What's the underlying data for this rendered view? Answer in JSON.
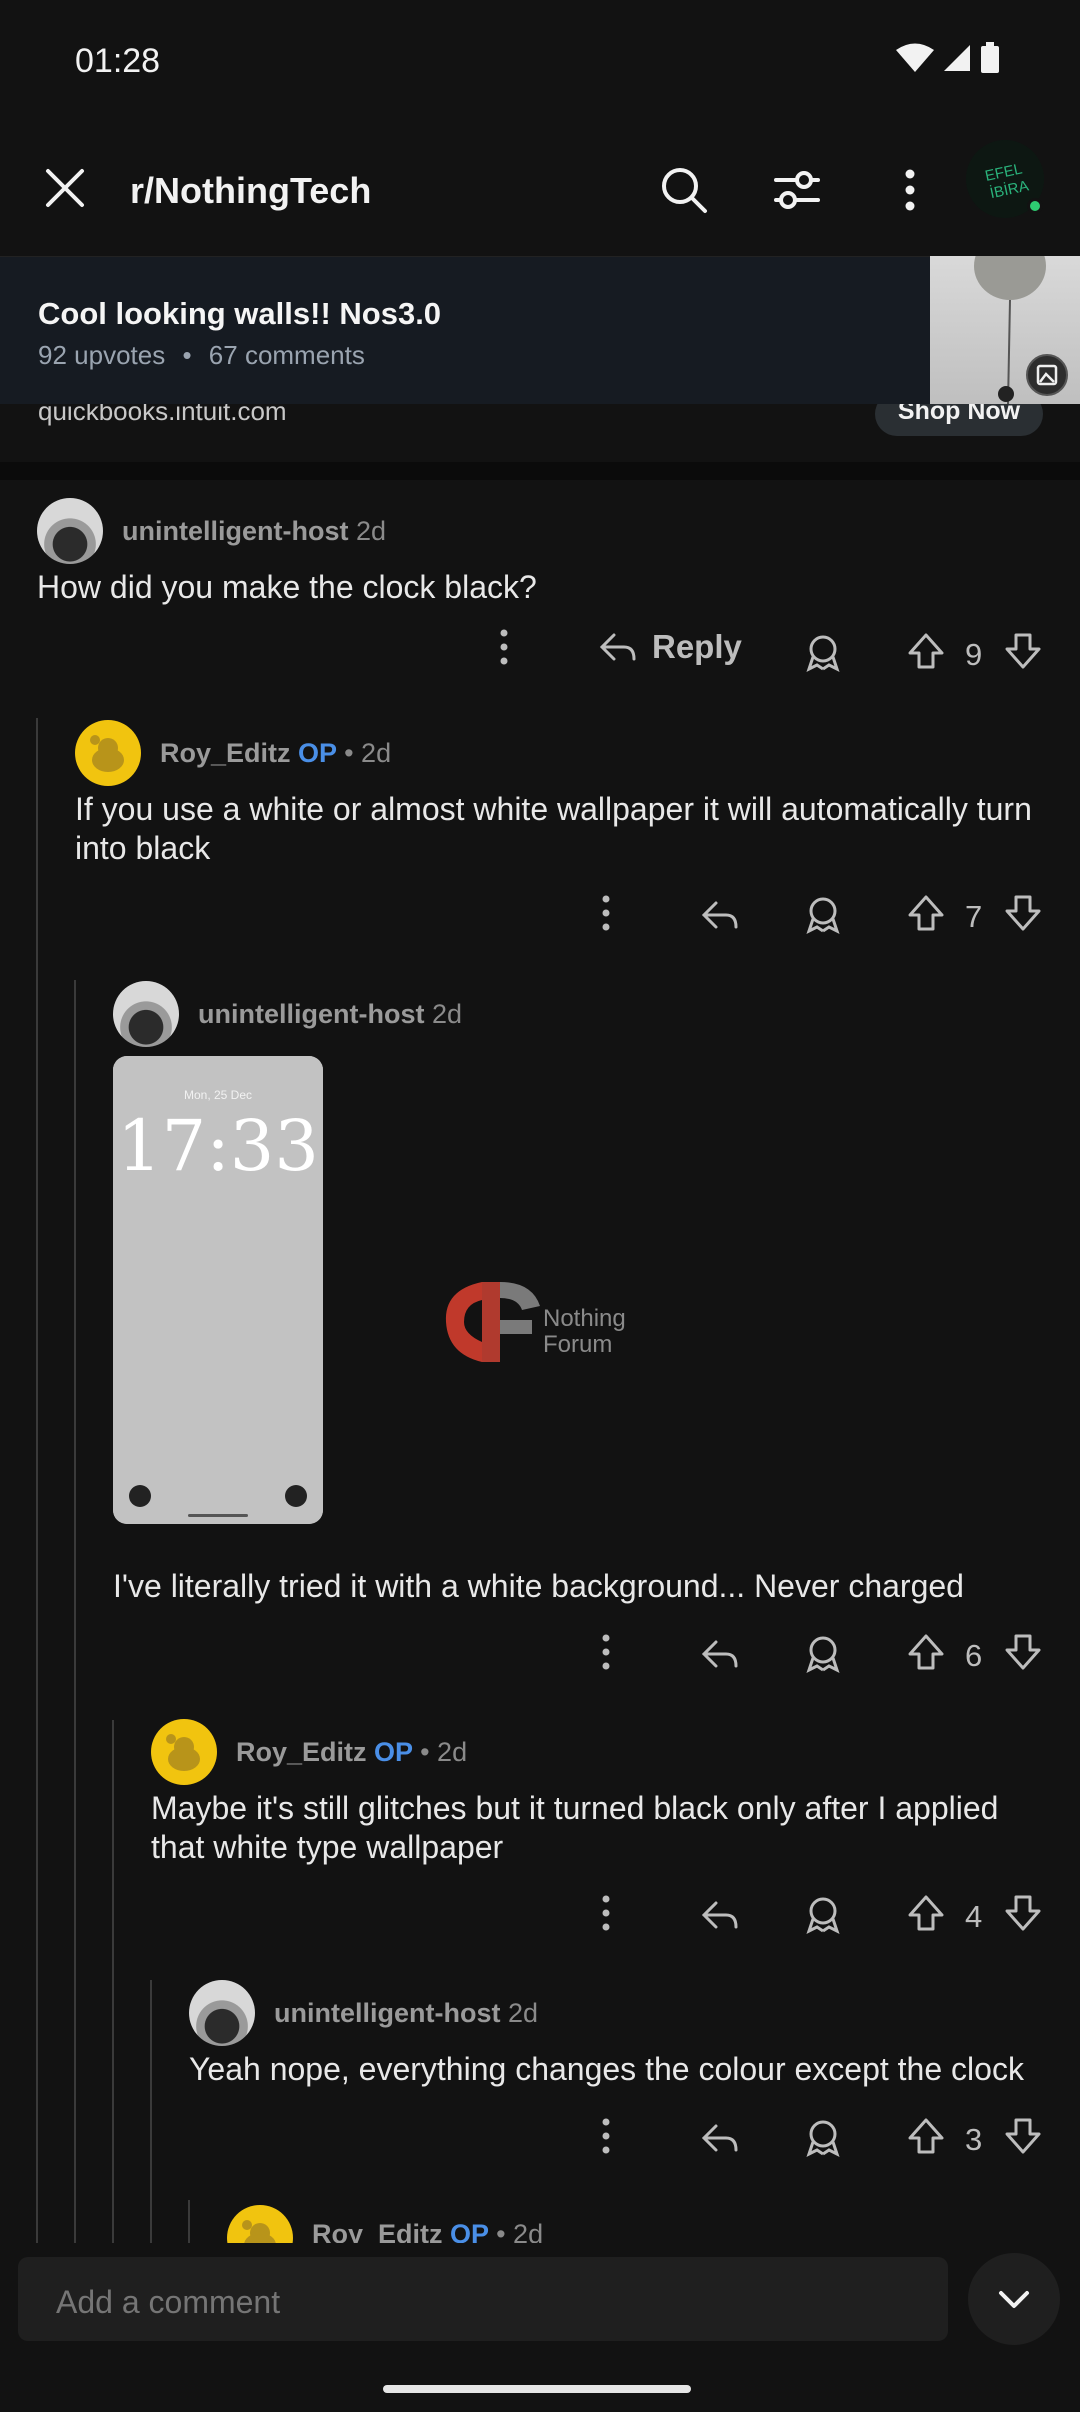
{
  "status_bar": {
    "time": "01:28"
  },
  "header": {
    "subreddit": "r/NothingTech",
    "avatar_text": "EFEL İBİRA"
  },
  "post": {
    "title": "Cool looking walls!! Nos3.0",
    "upvotes": "92 upvotes",
    "separator": "•",
    "comments": "67 comments"
  },
  "ad": {
    "url": "quickbooks.intuit.com",
    "cta": "Shop Now"
  },
  "comments": [
    {
      "user": "unintelligent-host",
      "time": "2d",
      "op": "",
      "text": "How did you make the clock black?",
      "reply_label": "Reply",
      "votes": "9"
    },
    {
      "user": "Roy_Editz",
      "op": "OP",
      "time": "• 2d",
      "text": "If you use a white or almost white wallpaper it will automatically turn into black",
      "votes": "7"
    },
    {
      "user": "unintelligent-host",
      "time": "2d",
      "op": "",
      "text": "I've literally tried it with a white background... Never charged",
      "votes": "6",
      "image": {
        "date": "Mon, 25 Dec",
        "clock": "17:33",
        "watermark_line1": "Nothing",
        "watermark_line2": "Forum"
      }
    },
    {
      "user": "Roy_Editz",
      "op": "OP",
      "time": "• 2d",
      "text": "Maybe it's still glitches but it turned black only after I applied that white type wallpaper",
      "votes": "4"
    },
    {
      "user": "unintelligent-host",
      "time": "2d",
      "op": "",
      "text": "Yeah nope, everything changes the colour except the clock",
      "votes": "3"
    },
    {
      "user": "Roy_Editz",
      "op": "OP",
      "time": "• 2d"
    }
  ],
  "composer": {
    "placeholder": "Add a comment"
  },
  "colors": {
    "op": "#4a8fe7",
    "background": "#121212",
    "online": "#2ecc71"
  }
}
